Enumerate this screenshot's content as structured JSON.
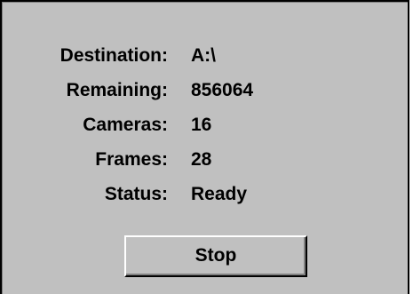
{
  "rows": [
    {
      "label": "Destination:",
      "value": "A:\\"
    },
    {
      "label": "Remaining:",
      "value": "856064"
    },
    {
      "label": "Cameras:",
      "value": "16"
    },
    {
      "label": "Frames:",
      "value": "28"
    },
    {
      "label": "Status:",
      "value": "Ready"
    }
  ],
  "buttons": {
    "stop_label": "Stop"
  },
  "colors": {
    "face": "#c0c0c0",
    "frame": "#000000"
  }
}
